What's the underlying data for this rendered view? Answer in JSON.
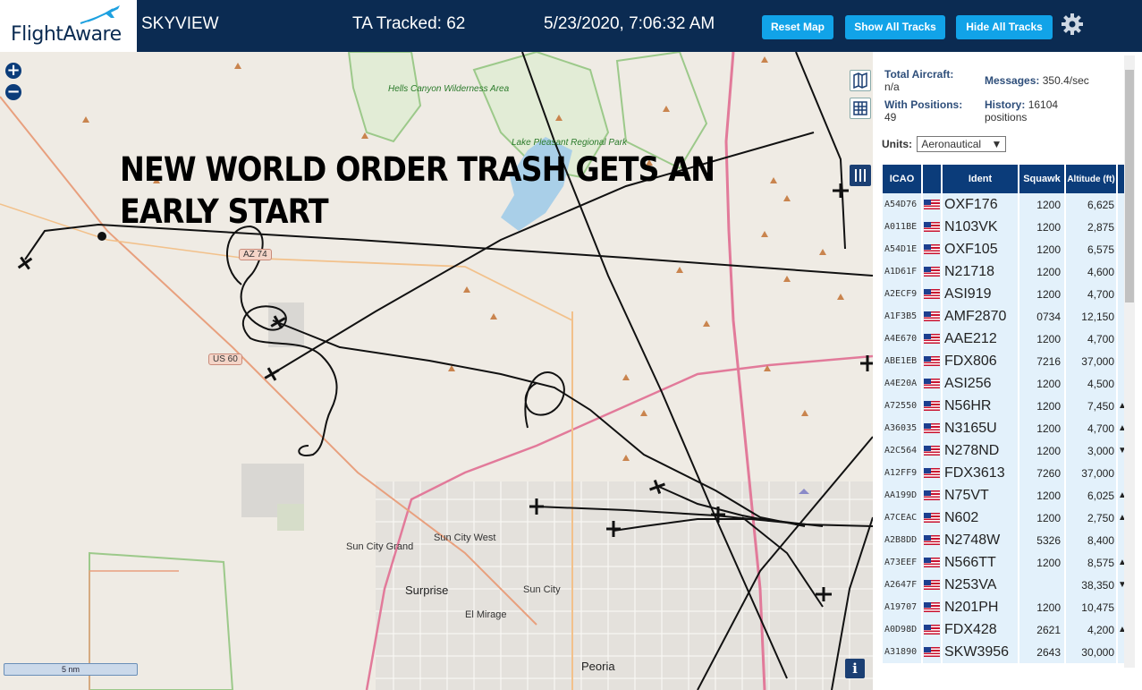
{
  "header": {
    "logo_text": "FlightAware",
    "app_title": "SKYVIEW",
    "tracked": "TA Tracked: 62",
    "datetime": "5/23/2020, 7:06:32 AM",
    "buttons": [
      "Reset Map",
      "Show All Tracks",
      "Hide All Tracks"
    ],
    "settings_icon": "gear-icon"
  },
  "map": {
    "zoom_in": "+",
    "zoom_out": "−",
    "overlay_text": "NEW WORLD ORDER TRASH GETS AN EARLY START",
    "scale_label": "5 nm",
    "info_label": "i",
    "labels": {
      "hells_canyon": "Hells Canyon Wilderness Area",
      "lake_pleasant": "Lake Pleasant Regional Park",
      "sun_city_grand": "Sun City Grand",
      "sun_city_west": "Sun City West",
      "surprise": "Surprise",
      "sun_city": "Sun City",
      "el_mirage": "El Mirage",
      "peoria": "Peoria"
    },
    "shields": {
      "az74": "AZ 74",
      "us60": "US 60"
    },
    "colors": {
      "track": "#111111",
      "highway": "#e27a9a",
      "park": "#a9d49b",
      "water": "#9cc8e8"
    }
  },
  "stats": {
    "total_aircraft_label": "Total Aircraft:",
    "total_aircraft_value": "n/a",
    "messages_label": "Messages:",
    "messages_value": "350.4/sec",
    "with_positions_label": "With Positions:",
    "with_positions_value": "49",
    "history_label": "History:",
    "history_value": "16104 positions",
    "units_label": "Units:",
    "units_value": "Aeronautical"
  },
  "table": {
    "headers": {
      "icao": "ICAO",
      "ident": "Ident",
      "squawk": "Squawk",
      "altitude": "Altitude (ft)"
    },
    "rows": [
      {
        "icao": "A54D76",
        "ident": "OXF176",
        "squawk": "1200",
        "alt": "6,625",
        "trend": ""
      },
      {
        "icao": "A011BE",
        "ident": "N103VK",
        "squawk": "1200",
        "alt": "2,875",
        "trend": ""
      },
      {
        "icao": "A54D1E",
        "ident": "OXF105",
        "squawk": "1200",
        "alt": "6,575",
        "trend": ""
      },
      {
        "icao": "A1D61F",
        "ident": "N21718",
        "squawk": "1200",
        "alt": "4,600",
        "trend": ""
      },
      {
        "icao": "A2ECF9",
        "ident": "ASI919",
        "squawk": "1200",
        "alt": "4,700",
        "trend": ""
      },
      {
        "icao": "A1F3B5",
        "ident": "AMF2870",
        "squawk": "0734",
        "alt": "12,150",
        "trend": ""
      },
      {
        "icao": "A4E670",
        "ident": "AAE212",
        "squawk": "1200",
        "alt": "4,700",
        "trend": ""
      },
      {
        "icao": "ABE1EB",
        "ident": "FDX806",
        "squawk": "7216",
        "alt": "37,000",
        "trend": ""
      },
      {
        "icao": "A4E20A",
        "ident": "ASI256",
        "squawk": "1200",
        "alt": "4,500",
        "trend": ""
      },
      {
        "icao": "A72550",
        "ident": "N56HR",
        "squawk": "1200",
        "alt": "7,450",
        "trend": "▲"
      },
      {
        "icao": "A36035",
        "ident": "N3165U",
        "squawk": "1200",
        "alt": "4,700",
        "trend": "▲"
      },
      {
        "icao": "A2C564",
        "ident": "N278ND",
        "squawk": "1200",
        "alt": "3,000",
        "trend": "▼"
      },
      {
        "icao": "A12FF9",
        "ident": "FDX3613",
        "squawk": "7260",
        "alt": "37,000",
        "trend": ""
      },
      {
        "icao": "AA199D",
        "ident": "N75VT",
        "squawk": "1200",
        "alt": "6,025",
        "trend": "▲"
      },
      {
        "icao": "A7CEAC",
        "ident": "N602",
        "squawk": "1200",
        "alt": "2,750",
        "trend": "▲"
      },
      {
        "icao": "A2B8DD",
        "ident": "N2748W",
        "squawk": "5326",
        "alt": "8,400",
        "trend": ""
      },
      {
        "icao": "A73EEF",
        "ident": "N566TT",
        "squawk": "1200",
        "alt": "8,575",
        "trend": "▲"
      },
      {
        "icao": "A2647F",
        "ident": "N253VA",
        "squawk": "",
        "alt": "38,350",
        "trend": "▼"
      },
      {
        "icao": "A19707",
        "ident": "N201PH",
        "squawk": "1200",
        "alt": "10,475",
        "trend": ""
      },
      {
        "icao": "A0D98D",
        "ident": "FDX428",
        "squawk": "2621",
        "alt": "4,200",
        "trend": "▲"
      },
      {
        "icao": "A31890",
        "ident": "SKW3956",
        "squawk": "2643",
        "alt": "30,000",
        "trend": ""
      }
    ]
  }
}
